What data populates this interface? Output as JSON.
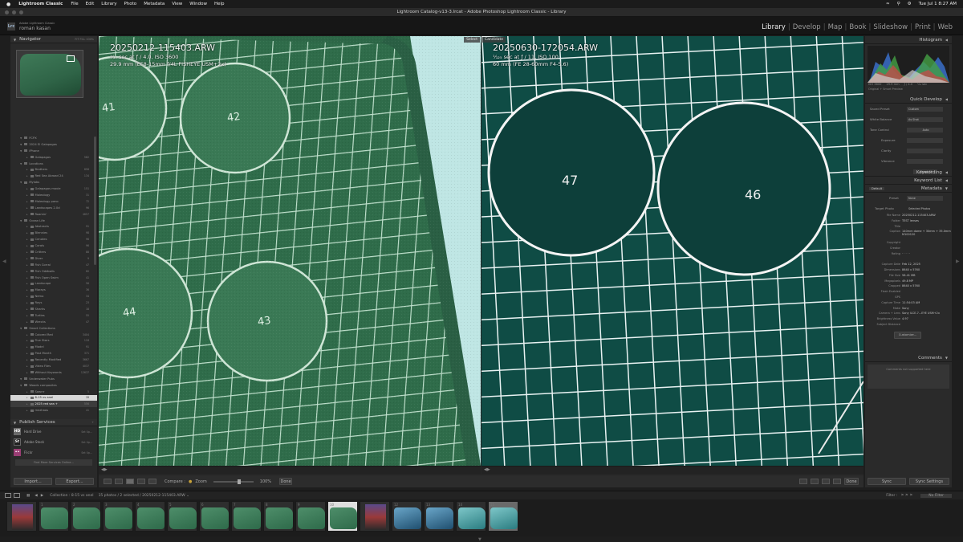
{
  "menubar": {
    "app_name": "Lightroom Classic",
    "items": [
      "File",
      "Edit",
      "Library",
      "Photo",
      "Metadata",
      "View",
      "Window",
      "Help"
    ],
    "clock": "Tue Jul 1  8:27 AM"
  },
  "window": {
    "title": "Lightroom Catalog-v13-3.lrcat - Adobe Photoshop Lightroom Classic - Library"
  },
  "identity": {
    "logo": "Lrc",
    "small_label": "Adobe Lightroom Classic",
    "user_name": "roman kasan",
    "modules": [
      "Library",
      "Develop",
      "Map",
      "Book",
      "Slideshow",
      "Print",
      "Web"
    ],
    "active_module": "Library"
  },
  "left_panel": {
    "navigator_title": "Navigator",
    "navigator_zoom": "FIT  FILL  100%",
    "collections": [
      {
        "label": "FCPX",
        "count": ""
      },
      {
        "label": "2024 El Galapagos",
        "count": ""
      },
      {
        "label": "iPhone",
        "count": ""
      },
      {
        "label": "Galapagos",
        "count": "582"
      },
      {
        "label": "Locations",
        "count": ""
      },
      {
        "label": "Brothers",
        "count": "856"
      },
      {
        "label": "Red Sea Abroad 24",
        "count": "134"
      },
      {
        "label": "Mylabs",
        "count": ""
      },
      {
        "label": "Galapagos movie",
        "count": "151"
      },
      {
        "label": "Moleology",
        "count": "31"
      },
      {
        "label": "Moleology pano",
        "count": "72"
      },
      {
        "label": "Landscapes 2.0d",
        "count": "96"
      },
      {
        "label": "Roamin'",
        "count": "4657"
      },
      {
        "label": "Ocean Life",
        "count": ""
      },
      {
        "label": "Abstracts",
        "count": "91"
      },
      {
        "label": "Blennies",
        "count": "98"
      },
      {
        "label": "Cenotes",
        "count": "96"
      },
      {
        "label": "Corals",
        "count": "96"
      },
      {
        "label": "Critters",
        "count": "88"
      },
      {
        "label": "Diver",
        "count": "9"
      },
      {
        "label": "Fish Corral",
        "count": "47"
      },
      {
        "label": "Fish Oddballs",
        "count": "60"
      },
      {
        "label": "Fish Open Swim",
        "count": "41"
      },
      {
        "label": "Landscape",
        "count": "56"
      },
      {
        "label": "Morays",
        "count": "36"
      },
      {
        "label": "Nemo",
        "count": "34"
      },
      {
        "label": "Rays",
        "count": "23"
      },
      {
        "label": "Sharks",
        "count": "18"
      },
      {
        "label": "Turtles",
        "count": "55"
      },
      {
        "label": "Wrecks",
        "count": "47"
      },
      {
        "label": "Smart Collections",
        "count": ""
      },
      {
        "label": "Colored Red",
        "count": "3404"
      },
      {
        "label": "Five Stars",
        "count": "118"
      },
      {
        "label": "Model",
        "count": "91"
      },
      {
        "label": "Past Month",
        "count": "371"
      },
      {
        "label": "Recently Modified",
        "count": "3667"
      },
      {
        "label": "Video Files",
        "count": "4037"
      },
      {
        "label": "Without Keywords",
        "count": "12637"
      },
      {
        "label": "Underwater Pubs",
        "count": ""
      },
      {
        "label": "Woods composites",
        "count": ""
      },
      {
        "label": "Sawrrr",
        "count": "5"
      },
      {
        "label": "8-15 vs anel",
        "count": "15"
      },
      {
        "label": "2025 red sea +",
        "count": "556"
      },
      {
        "label": "mezhaos",
        "count": "41"
      }
    ],
    "selected_index": 41,
    "highlight_index": 42,
    "publish_title": "Publish Services",
    "publish_services": [
      {
        "label": "Hard Drive",
        "setup": "Set Up...",
        "icon": "HD",
        "color": "#6b6b6b"
      },
      {
        "label": "Adobe Stock",
        "setup": "Set Up...",
        "icon": "St",
        "color": "#2a2a2a"
      },
      {
        "label": "Flickr",
        "setup": "Set Up...",
        "icon": "••",
        "color": "#9a3d74"
      }
    ],
    "find_more": "Find More Services Online...",
    "import_label": "Import...",
    "export_label": "Export..."
  },
  "center": {
    "select_tag": "Select",
    "candidate_tag": "Candidate",
    "select": {
      "filename": "20250212-115403.ARW",
      "line1": "⅟₃₀ sec at ƒ / 4.0, ISO 3600",
      "line2": "29.9 mm (EF8-15mm f/4L FISHEYE USM+2x)",
      "circles": [
        "41",
        "42",
        "44",
        "43"
      ]
    },
    "candidate": {
      "filename": "20250630-172054.ARW",
      "line1": "⅟₁₂₅ sec at ƒ / 11, ISO 100",
      "line2": "60 mm (FE 28-60mm F4-5.6)",
      "circles": [
        "47",
        "46"
      ]
    },
    "toolbar": {
      "compare_label": "Compare :",
      "zoom_label": "Zoom",
      "zoom_value": "100%",
      "done_label": "Done"
    }
  },
  "right_panel": {
    "histogram_title": "Histogram",
    "hist_meta": [
      "ISO 3600",
      "29.9 mm",
      "ƒ / 4.0",
      "⅟₃₀ sec"
    ],
    "hist_preview": "Original + Smart Preview",
    "quick_develop_title": "Quick Develop",
    "saved_preset_label": "Saved Preset",
    "saved_preset_value": "Custom",
    "white_balance_label": "White Balance",
    "white_balance_value": "As Shot",
    "tone_control_label": "Tone Control",
    "tone_control_value": "Auto",
    "tone_rows": [
      "Exposure",
      "Clarity",
      "Vibrance"
    ],
    "reset_all": "Reset All",
    "keywording_title": "Keywording",
    "keyword_list_title": "Keyword List",
    "metadata_title": "Metadata",
    "metadata_preset": "Default",
    "preset_label": "Preset",
    "preset_value": "None",
    "target_photo_label": "Target Photo",
    "target_photo_value": "Selected Photos",
    "metadata": [
      {
        "k": "File Name",
        "v": "20250212-115403.ARW"
      },
      {
        "k": "Folder",
        "v": "TEST lenses"
      },
      {
        "k": "Title",
        "v": ""
      },
      {
        "k": "Caption",
        "v": "140mm dome + 30mm + 35.0mm M100120"
      },
      {
        "k": "",
        "v": ""
      },
      {
        "k": "Copyright",
        "v": ""
      },
      {
        "k": "Creator",
        "v": ""
      },
      {
        "k": "Rating",
        "v": "· · · · ·"
      },
      {
        "k": "",
        "v": ""
      },
      {
        "k": "Capture Date",
        "v": "Feb 12, 2025"
      },
      {
        "k": "Dimensions",
        "v": "8640 x 5760"
      },
      {
        "k": "File Size",
        "v": "58.41 MB"
      },
      {
        "k": "Megapixels",
        "v": "49.8 MP"
      },
      {
        "k": "Cropped",
        "v": "8640 x 5760"
      },
      {
        "k": "Flash Enabled",
        "v": ""
      },
      {
        "k": "GPS",
        "v": ""
      },
      {
        "k": "Capture Time",
        "v": "11:54:03 AM"
      },
      {
        "k": "Make",
        "v": "Sony"
      },
      {
        "k": "Camera + Lens",
        "v": "Sony ILCE-7...EYE USM+2x"
      },
      {
        "k": "Brightness Value",
        "v": "4.97"
      },
      {
        "k": "Subject Distance",
        "v": ""
      }
    ],
    "customize_label": "Customize...",
    "comments_title": "Comments",
    "comments_placeholder": "Comments not supported here",
    "sync_label": "Sync",
    "sync_settings_label": "Sync Settings"
  },
  "filmstrip": {
    "source": "Collection : 8-15 vs anel",
    "info": "15 photos / 2 selected / 20250212-115403.ARW ⌄",
    "filter_label": "Filter :",
    "filter_value": "No Filter",
    "cells": [
      {
        "num": "",
        "type": "cover"
      },
      {
        "num": "1",
        "type": "green"
      },
      {
        "num": "2",
        "type": "green"
      },
      {
        "num": "3",
        "type": "green"
      },
      {
        "num": "4",
        "type": "green"
      },
      {
        "num": "5",
        "type": "green"
      },
      {
        "num": "6",
        "type": "green"
      },
      {
        "num": "7",
        "type": "green"
      },
      {
        "num": "8",
        "type": "green"
      },
      {
        "num": "9",
        "type": "green"
      },
      {
        "num": "10",
        "type": "green-sel"
      },
      {
        "num": "",
        "type": "cover"
      },
      {
        "num": "12",
        "type": "blue"
      },
      {
        "num": "13",
        "type": "blue"
      },
      {
        "num": "14",
        "type": "teal"
      },
      {
        "num": "15",
        "type": "teal-cand"
      }
    ]
  }
}
